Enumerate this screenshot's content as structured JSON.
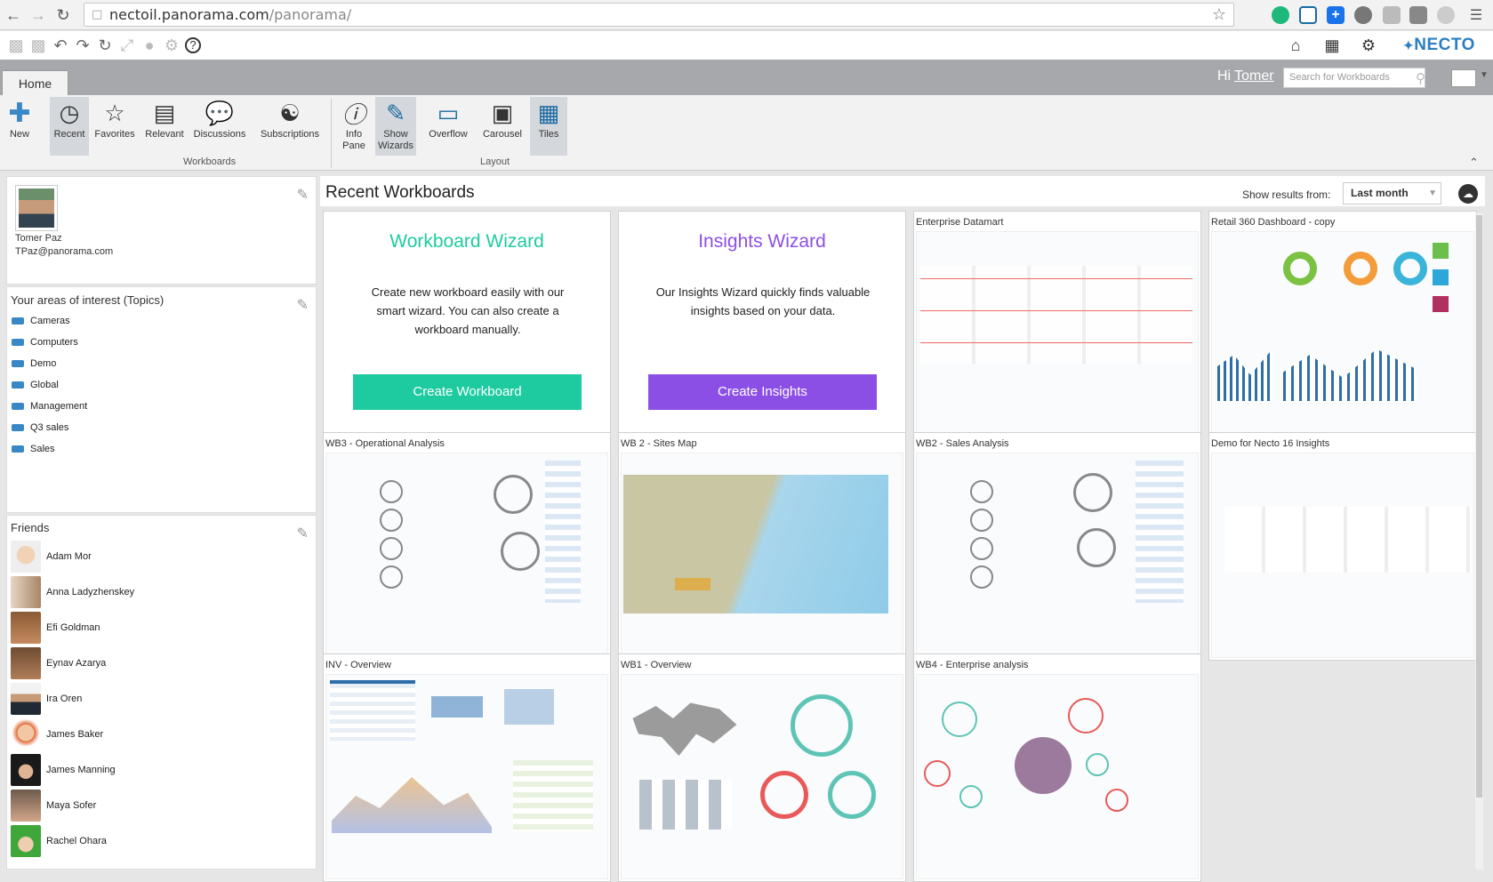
{
  "browser": {
    "url_host": "nectoil.panorama.com",
    "url_path": "/panorama/"
  },
  "ribbon": {
    "tab": "Home",
    "greeting": "Hi",
    "user": "Tomer",
    "search_placeholder": "Search for Workboards",
    "buttons": {
      "new": "New",
      "recent": "Recent",
      "favorites": "Favorites",
      "relevant": "Relevant",
      "discussions": "Discussions",
      "subscriptions": "Subscriptions",
      "info_pane_1": "Info",
      "info_pane_2": "Pane",
      "show_wizards_1": "Show",
      "show_wizards_2": "Wizards",
      "overflow": "Overflow",
      "carousel": "Carousel",
      "tiles": "Tiles"
    },
    "groups": {
      "workboards": "Workboards",
      "layout": "Layout"
    }
  },
  "brand": "NECTO",
  "profile": {
    "name": "Tomer Paz",
    "email": "TPaz@panorama.com"
  },
  "topics": {
    "title": "Your areas of interest (Topics)",
    "items": [
      "Cameras",
      "Computers",
      "Demo",
      "Global",
      "Management",
      "Q3 sales",
      "Sales"
    ]
  },
  "friends": {
    "title": "Friends",
    "items": [
      "Adam Mor",
      "Anna Ladyzhenskey",
      "Efi Goldman",
      "Eynav Azarya",
      "Ira Oren",
      "James Baker",
      "James Manning",
      "Maya Sofer",
      "Rachel Ohara"
    ]
  },
  "main": {
    "title": "Recent Workboards",
    "show_results_label": "Show results from:",
    "period": "Last month"
  },
  "wizards": {
    "workboard": {
      "title": "Workboard Wizard",
      "text": "Create new workboard easily with our smart wizard. You can also create a workboard manually.",
      "button": "Create Workboard",
      "color": "#1ecba0"
    },
    "insights": {
      "title": "Insights Wizard",
      "text": "Our Insights Wizard quickly finds valuable insights based on your data.",
      "button": "Create Insights",
      "color": "#8c4fe6"
    }
  },
  "workboards": [
    "Enterprise Datamart",
    "Retail 360 Dashboard - copy",
    "WB3 - Operational Analysis",
    "WB 2 - Sites Map",
    "WB2 - Sales Analysis",
    "Demo for Necto 16 Insights",
    "INV - Overview",
    "WB1 - Overview",
    "WB4 - Enterprise analysis"
  ]
}
